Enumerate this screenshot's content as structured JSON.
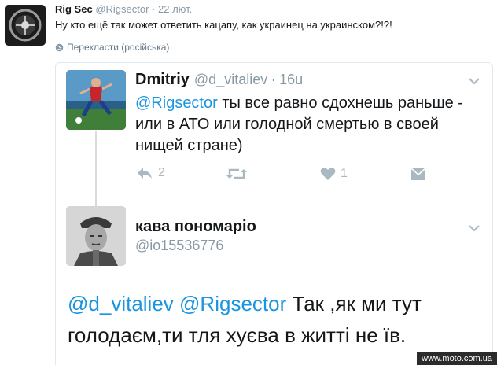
{
  "tweet": {
    "name": "Rig Sec",
    "handle": "@Rigsector",
    "separator": "·",
    "time": "22 лют.",
    "text": "Ну кто ещё так может ответить кацапу, как украинец на украинском?!?!",
    "translate_label": "Перекласти (російська)"
  },
  "quoted": {
    "reply": {
      "name": "Dmitriy",
      "handle": "@d_vitaliev",
      "separator": "·",
      "time": "16u",
      "mention": "@Rigsector",
      "text": " ты все равно сдохнешь раньше - или в АТО или голодной смертью в своей нищей стране)",
      "reply_count": "2",
      "like_count": "1"
    },
    "answer": {
      "name": "кава пономаріо",
      "handle": "@io15536776",
      "mention1": "@d_vitaliev",
      "mention2": "@Rigsector",
      "text": " Так ,як ми тут голодаєм,ти тля хуєва в житті не їв."
    }
  },
  "watermark": "www.moto.com.ua"
}
